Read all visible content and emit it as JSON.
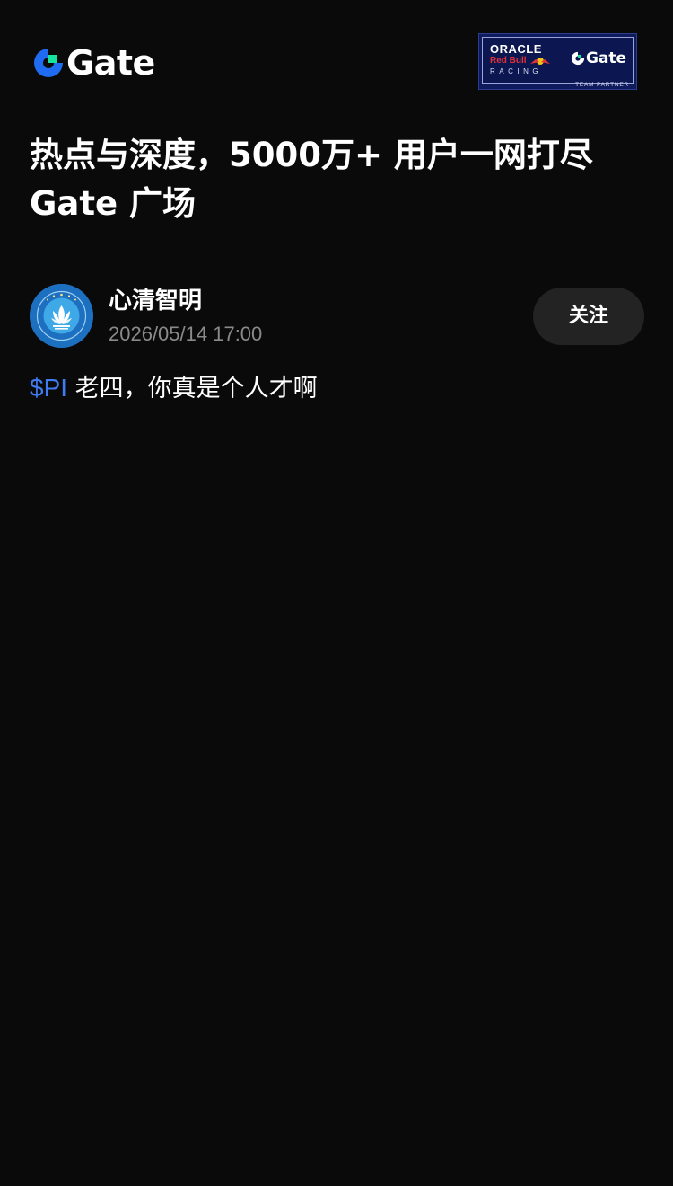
{
  "header": {
    "logo_text": "Gate",
    "partner_badge": {
      "line1": "ORACLE",
      "line2": "Red Bull",
      "line3": "RACING",
      "brand": "Gate",
      "caption": "TEAM PARTNER"
    }
  },
  "headline": "热点与深度，5000万+ 用户一网打尽 Gate 广场",
  "post": {
    "author": {
      "name": "心清智明",
      "timestamp": "2026/05/14 17:00",
      "follow_label": "关注"
    },
    "ticker": "$PI",
    "content": " 老四，你真是个人才啊"
  },
  "colors": {
    "background": "#0a0a0a",
    "link": "#3f7bf2",
    "muted_text": "#8a8a8a",
    "button_bg": "#232323",
    "brand_blue": "#1f6cf2",
    "brand_green": "#17e3a1"
  },
  "icons": {
    "logo": "gate-logo-icon",
    "avatar": "lotus-emblem-icon"
  }
}
